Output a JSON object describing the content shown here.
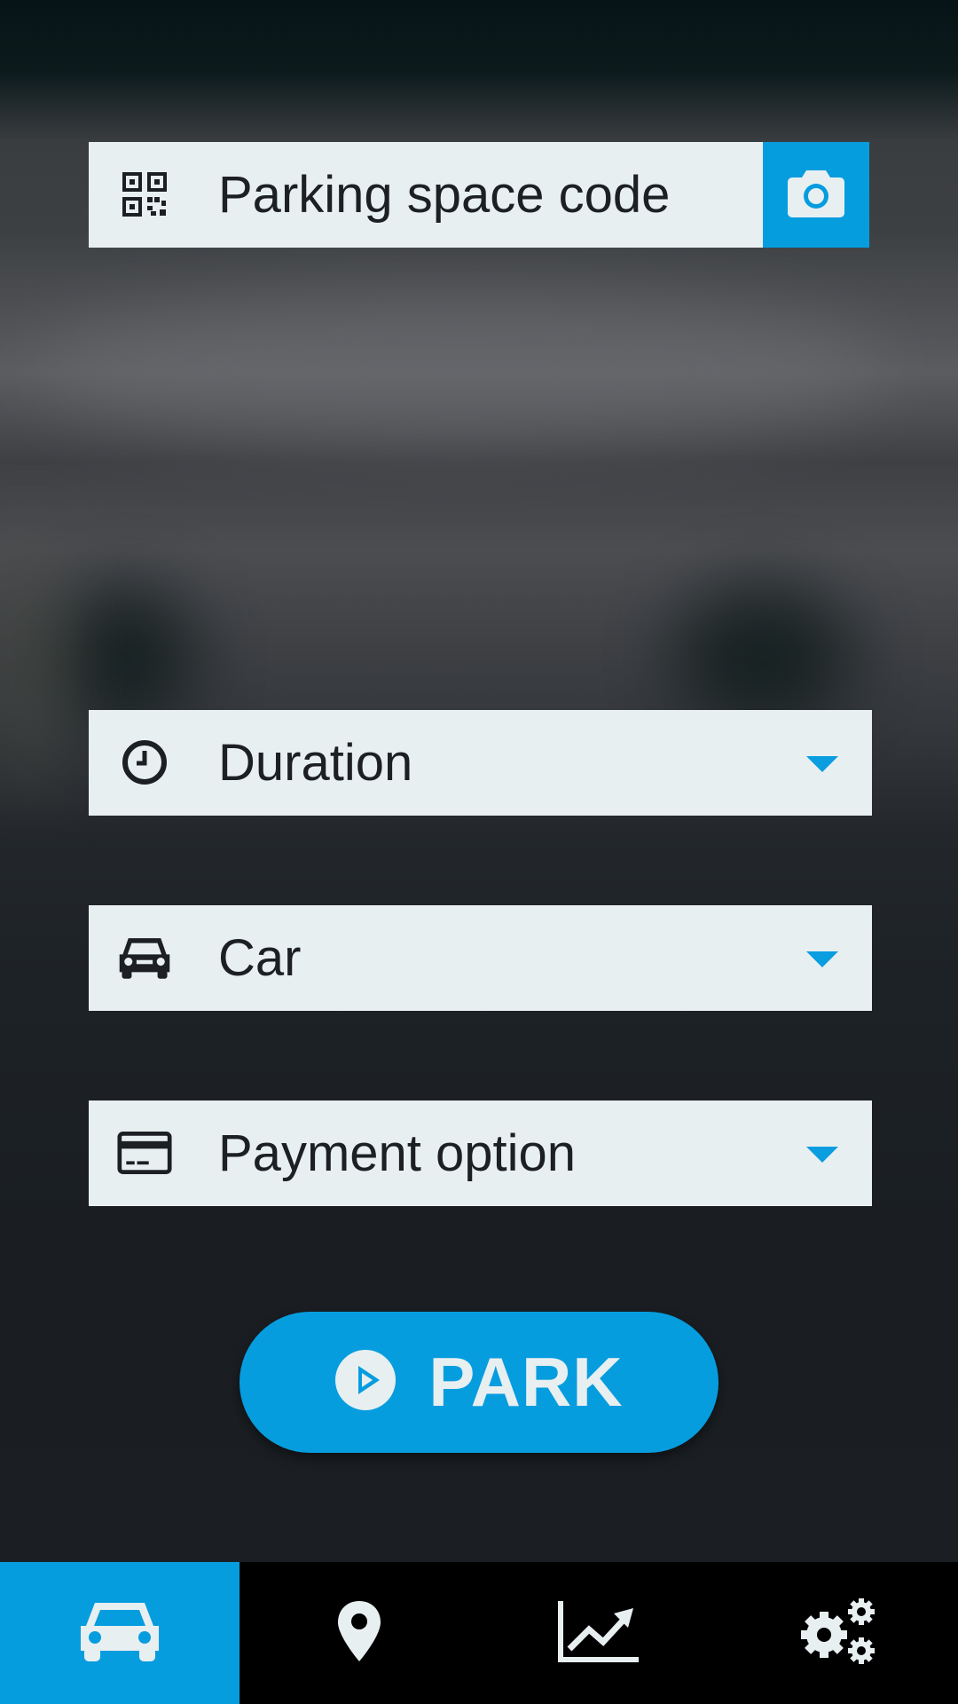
{
  "colors": {
    "accent": "#069ddf",
    "field_bg": "#e8eff0",
    "text": "#1c2025",
    "nav_bg": "#000000"
  },
  "form": {
    "parking_code": {
      "placeholder": "Parking space code",
      "icon": "qr-code-icon",
      "action_icon": "camera-icon"
    },
    "duration": {
      "label": "Duration",
      "icon": "clock-icon"
    },
    "car": {
      "label": "Car",
      "icon": "car-icon"
    },
    "payment": {
      "label": "Payment option",
      "icon": "credit-card-icon"
    }
  },
  "park_button": {
    "label": "PARK",
    "icon": "play-circle-icon"
  },
  "bottom_nav": {
    "items": [
      {
        "name": "park",
        "icon": "car-icon",
        "active": true
      },
      {
        "name": "map",
        "icon": "map-pin-icon",
        "active": false
      },
      {
        "name": "statistics",
        "icon": "chart-line-icon",
        "active": false
      },
      {
        "name": "settings",
        "icon": "gears-icon",
        "active": false
      }
    ]
  }
}
